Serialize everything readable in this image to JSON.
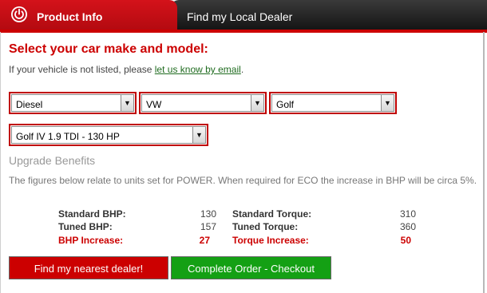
{
  "tabs": {
    "product_info": "Product Info",
    "local_dealer": "Find my Local Dealer"
  },
  "heading": "Select your car make and model:",
  "intro": {
    "prefix": "If your vehicle is not listed, please ",
    "link": "let us know by email",
    "suffix": "."
  },
  "selects": {
    "fuel": "Diesel",
    "make": "VW",
    "model": "Golf",
    "variant": "Golf IV 1.9 TDI - 130 HP"
  },
  "benefits": {
    "title": "Upgrade Benefits",
    "description": "The figures below relate to units set for POWER. When required for ECO the increase in BHP will be circa 5%.",
    "standard_bhp_label": "Standard BHP:",
    "standard_bhp": "130",
    "tuned_bhp_label": "Tuned BHP:",
    "tuned_bhp": "157",
    "bhp_increase_label": "BHP Increase:",
    "bhp_increase": "27",
    "standard_torque_label": "Standard Torque:",
    "standard_torque": "310",
    "tuned_torque_label": "Tuned Torque:",
    "tuned_torque": "360",
    "torque_increase_label": "Torque Increase:",
    "torque_increase": "50"
  },
  "buttons": {
    "dealer": "Find my nearest dealer!",
    "checkout": "Complete Order - Checkout"
  },
  "colors": {
    "accent_red": "#cc0000",
    "checkout_green": "#14a014",
    "tab_dark": "#1a1a1a"
  },
  "icons": {
    "product_tab": "power-icon",
    "select_arrow": "chevron-down-icon"
  }
}
